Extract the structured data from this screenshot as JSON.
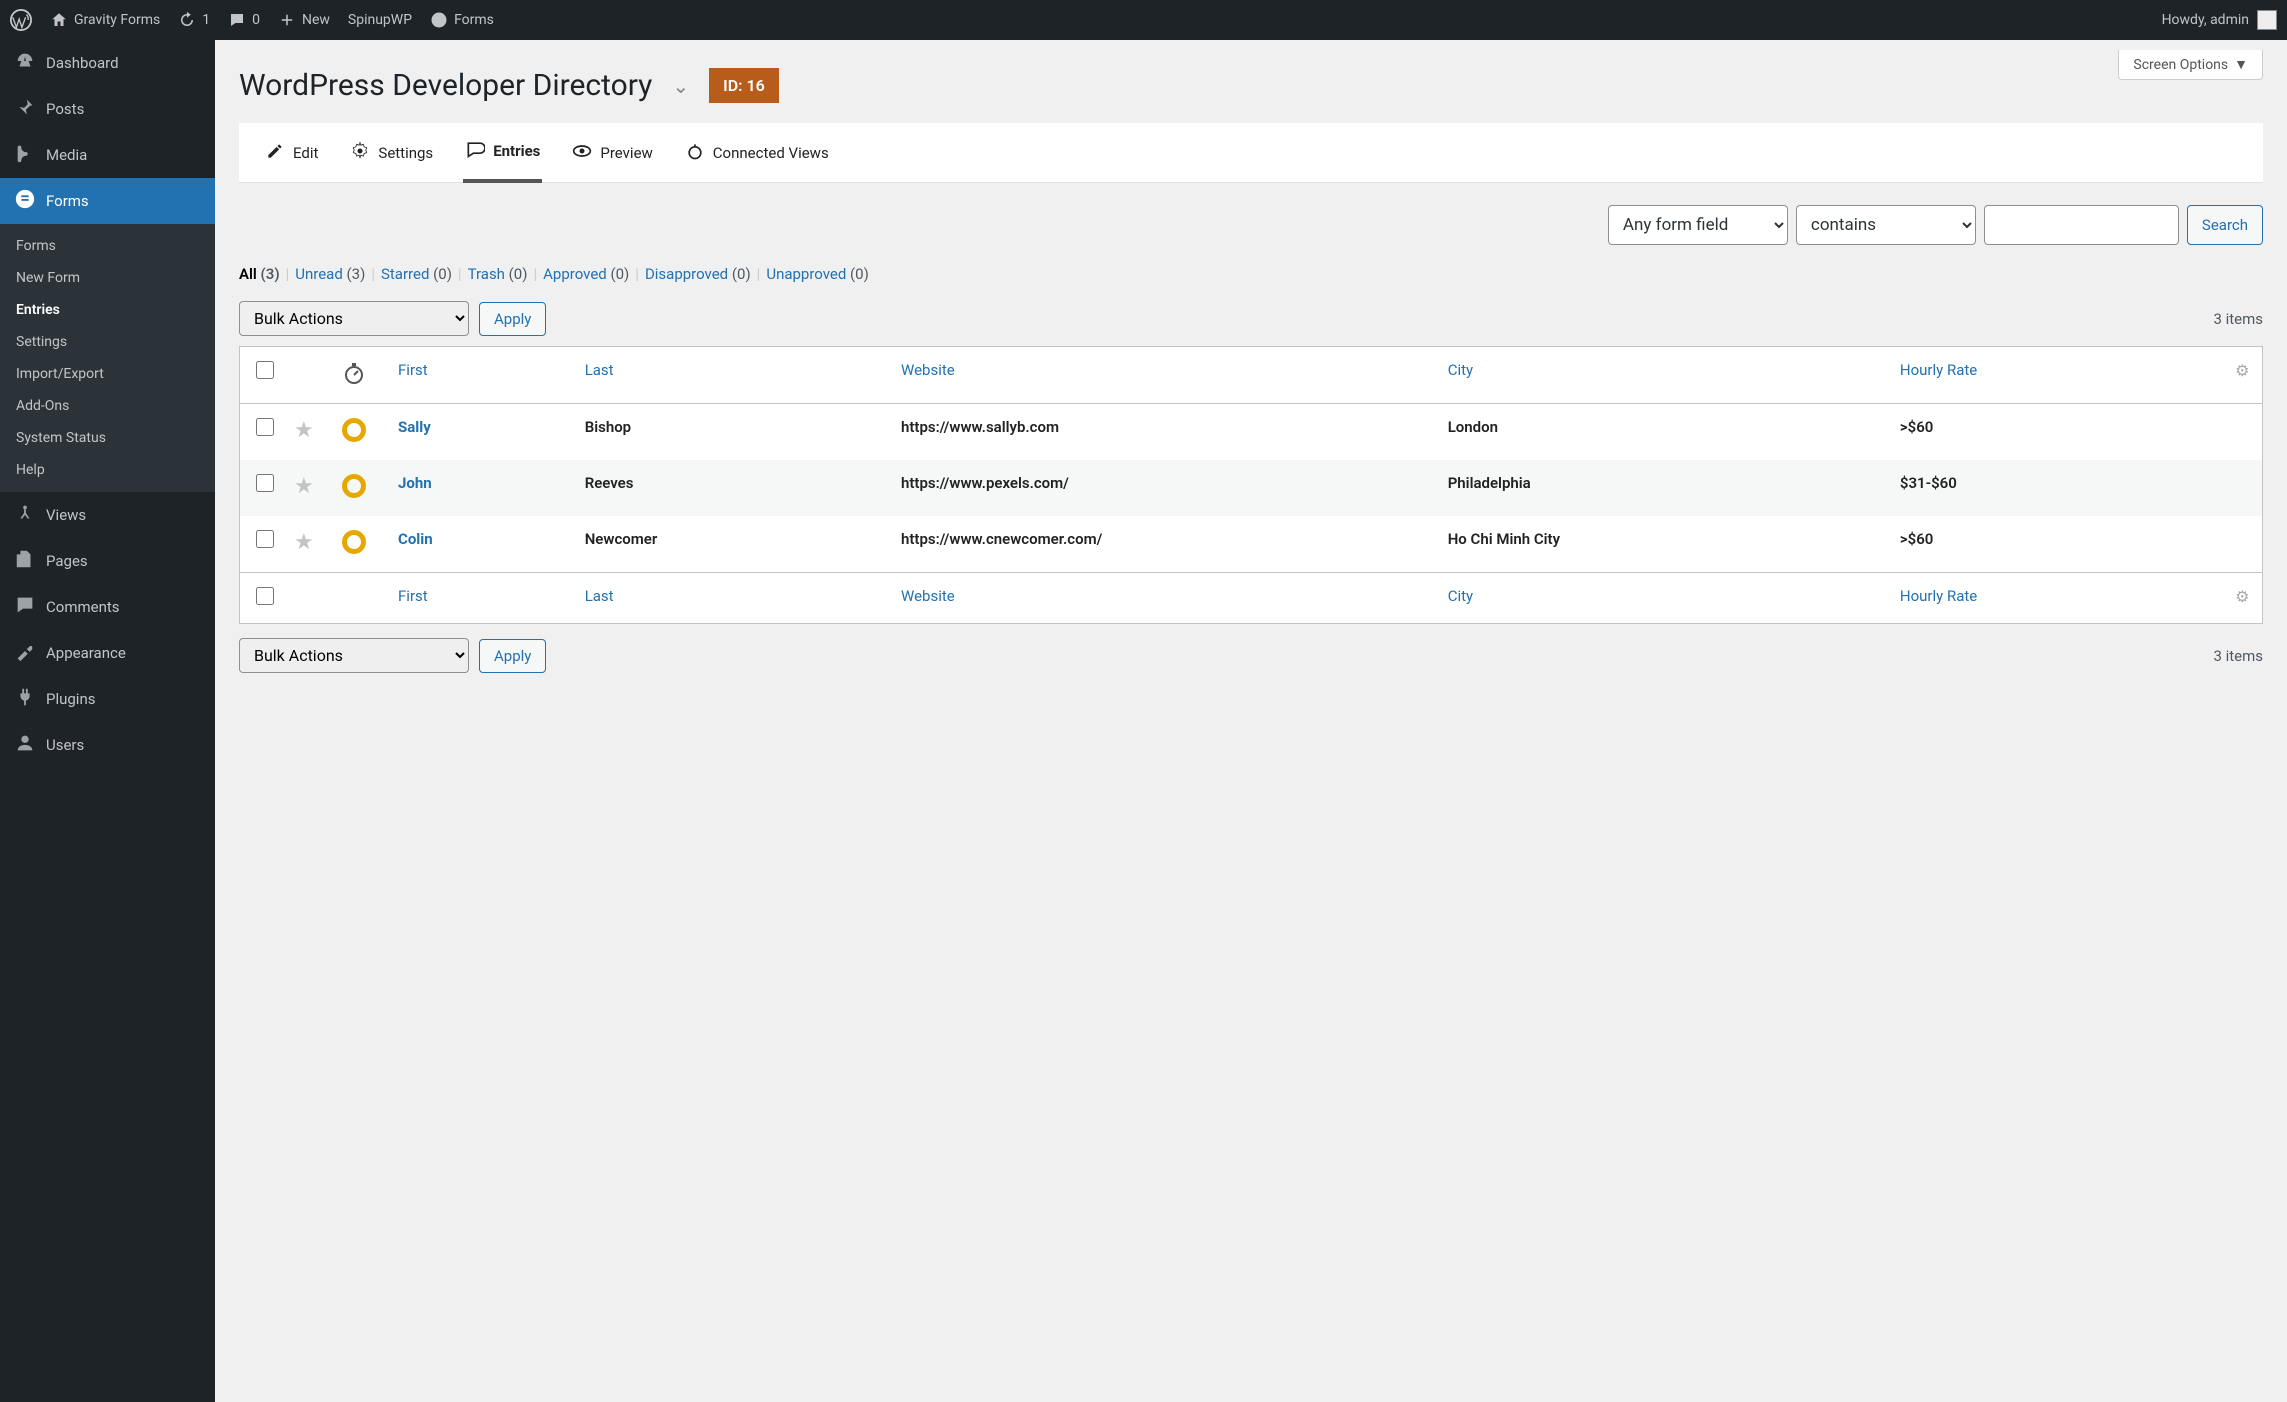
{
  "toolbar": {
    "site": "Gravity Forms",
    "updates": "1",
    "comments": "0",
    "new": "New",
    "spinup": "SpinupWP",
    "forms": "Forms",
    "howdy": "Howdy, admin"
  },
  "sidebar": {
    "main": [
      {
        "label": "Dashboard",
        "icon": "dashboard"
      },
      {
        "label": "Posts",
        "icon": "pin"
      },
      {
        "label": "Media",
        "icon": "media"
      },
      {
        "label": "Forms",
        "icon": "forms",
        "active": true
      },
      {
        "label": "Views",
        "icon": "views"
      },
      {
        "label": "Pages",
        "icon": "pages"
      },
      {
        "label": "Comments",
        "icon": "comments"
      },
      {
        "label": "Appearance",
        "icon": "appearance"
      },
      {
        "label": "Plugins",
        "icon": "plugins"
      },
      {
        "label": "Users",
        "icon": "users"
      }
    ],
    "sub": [
      "Forms",
      "New Form",
      "Entries",
      "Settings",
      "Import/Export",
      "Add-Ons",
      "System Status",
      "Help"
    ],
    "sub_current": "Entries"
  },
  "screen_options": "Screen Options",
  "page_title": "WordPress Developer Directory",
  "id_badge": "ID: 16",
  "tabs": [
    "Edit",
    "Settings",
    "Entries",
    "Preview",
    "Connected Views"
  ],
  "tabs_active": "Entries",
  "search": {
    "field_select": "Any form field",
    "operator": "contains",
    "button": "Search"
  },
  "filters": [
    {
      "label": "All",
      "count": "(3)",
      "active": true
    },
    {
      "label": "Unread",
      "count": "(3)"
    },
    {
      "label": "Starred",
      "count": "(0)"
    },
    {
      "label": "Trash",
      "count": "(0)"
    },
    {
      "label": "Approved",
      "count": "(0)"
    },
    {
      "label": "Disapproved",
      "count": "(0)"
    },
    {
      "label": "Unapproved",
      "count": "(0)"
    }
  ],
  "bulk": {
    "select": "Bulk Actions",
    "apply": "Apply"
  },
  "items_count": "3 items",
  "columns": [
    "First",
    "Last",
    "Website",
    "City",
    "Hourly Rate"
  ],
  "rows": [
    {
      "first": "Sally",
      "last": "Bishop",
      "website": "https://www.sallyb.com",
      "city": "London",
      "rate": ">$60"
    },
    {
      "first": "John",
      "last": "Reeves",
      "website": "https://www.pexels.com/",
      "city": "Philadelphia",
      "rate": "$31-$60"
    },
    {
      "first": "Colin",
      "last": "Newcomer",
      "website": "https://www.cnewcomer.com/",
      "city": "Ho Chi Minh City",
      "rate": ">$60"
    }
  ]
}
